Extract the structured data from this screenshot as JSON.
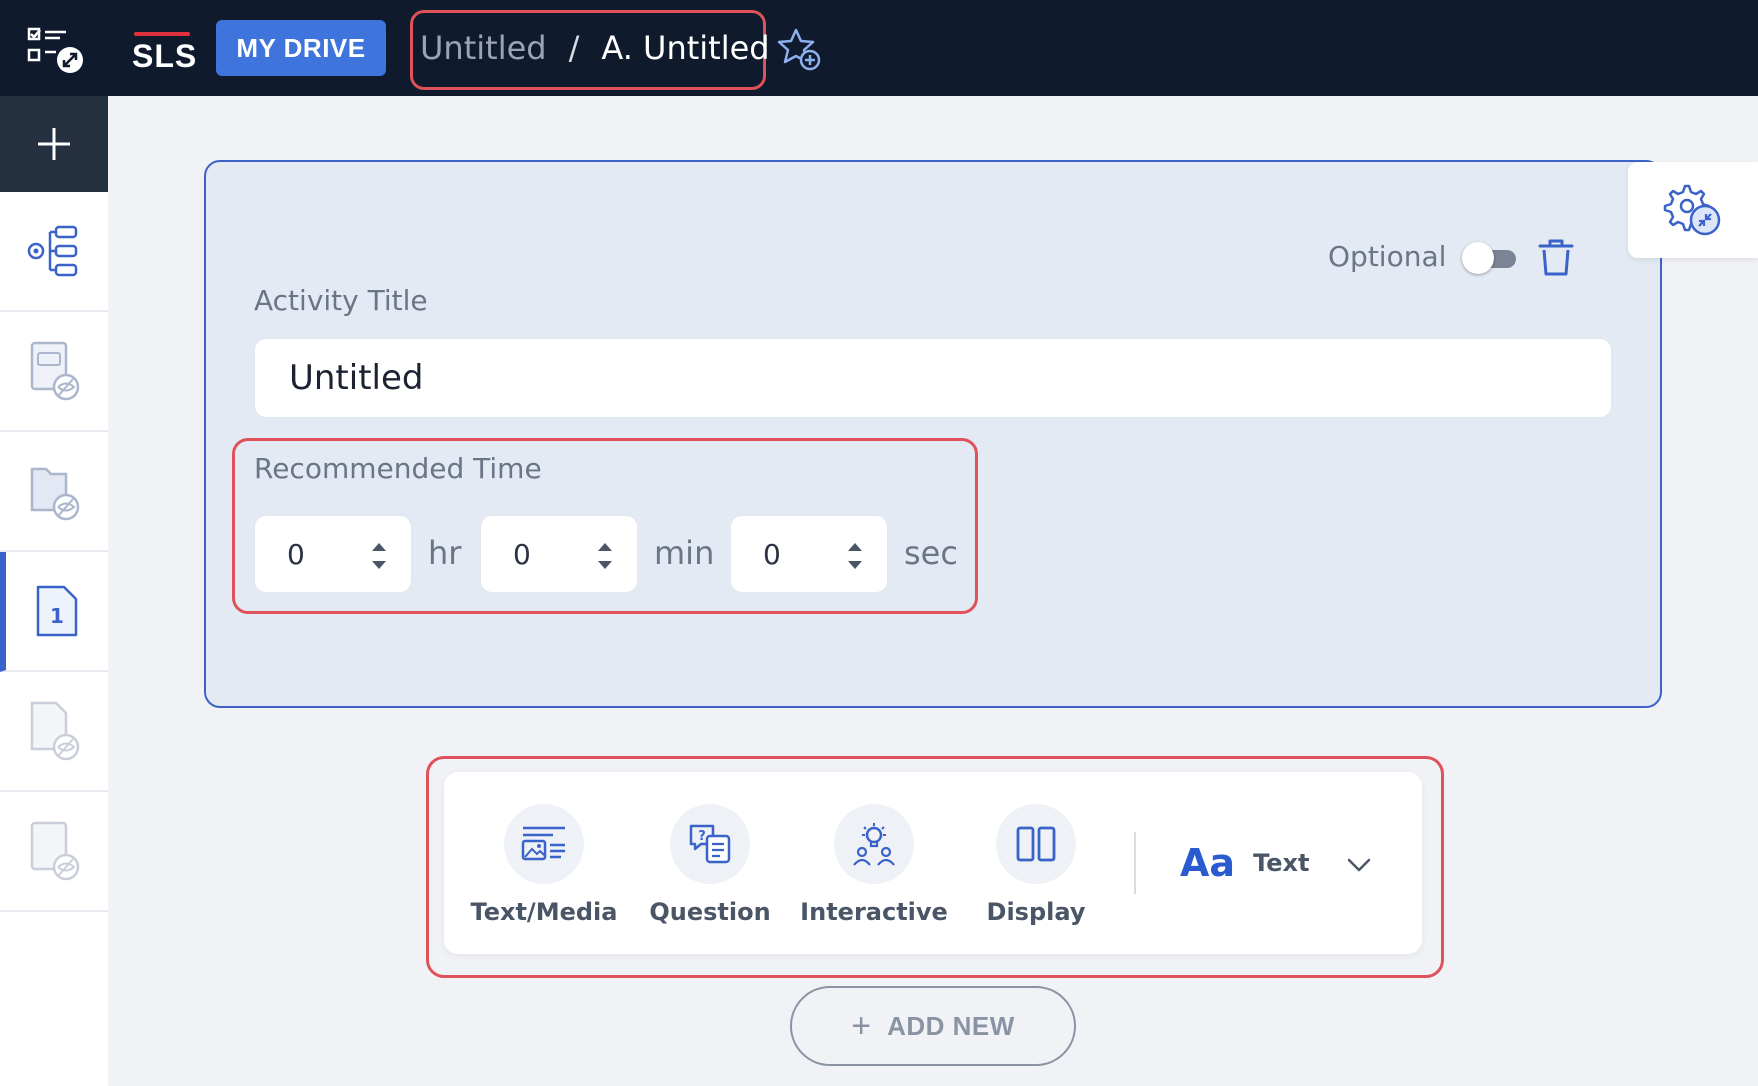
{
  "topbar": {
    "logo_text": "SLS",
    "drive_button": "MY DRIVE",
    "breadcrumb": [
      "Untitled",
      "/",
      "A. Untitled"
    ]
  },
  "card": {
    "optional_label": "Optional",
    "optional_on": false,
    "title_label": "Activity Title",
    "title_value": "Untitled",
    "time_label": "Recommended Time",
    "time": [
      {
        "value": "0",
        "unit": "hr"
      },
      {
        "value": "0",
        "unit": "min"
      },
      {
        "value": "0",
        "unit": "sec"
      }
    ]
  },
  "toolbar": {
    "items": [
      {
        "label": "Text/Media",
        "icon": "text-media-icon"
      },
      {
        "label": "Question",
        "icon": "question-icon"
      },
      {
        "label": "Interactive",
        "icon": "interactive-icon"
      },
      {
        "label": "Display",
        "icon": "display-icon"
      }
    ],
    "text_style_symbol": "Aa",
    "text_style_label": "Text"
  },
  "add_new": "ADD NEW",
  "colors": {
    "topbar": "#0f1b2d",
    "accent": "#3f74dc",
    "highlight": "#e0525a",
    "card_border": "#3d63c7"
  }
}
